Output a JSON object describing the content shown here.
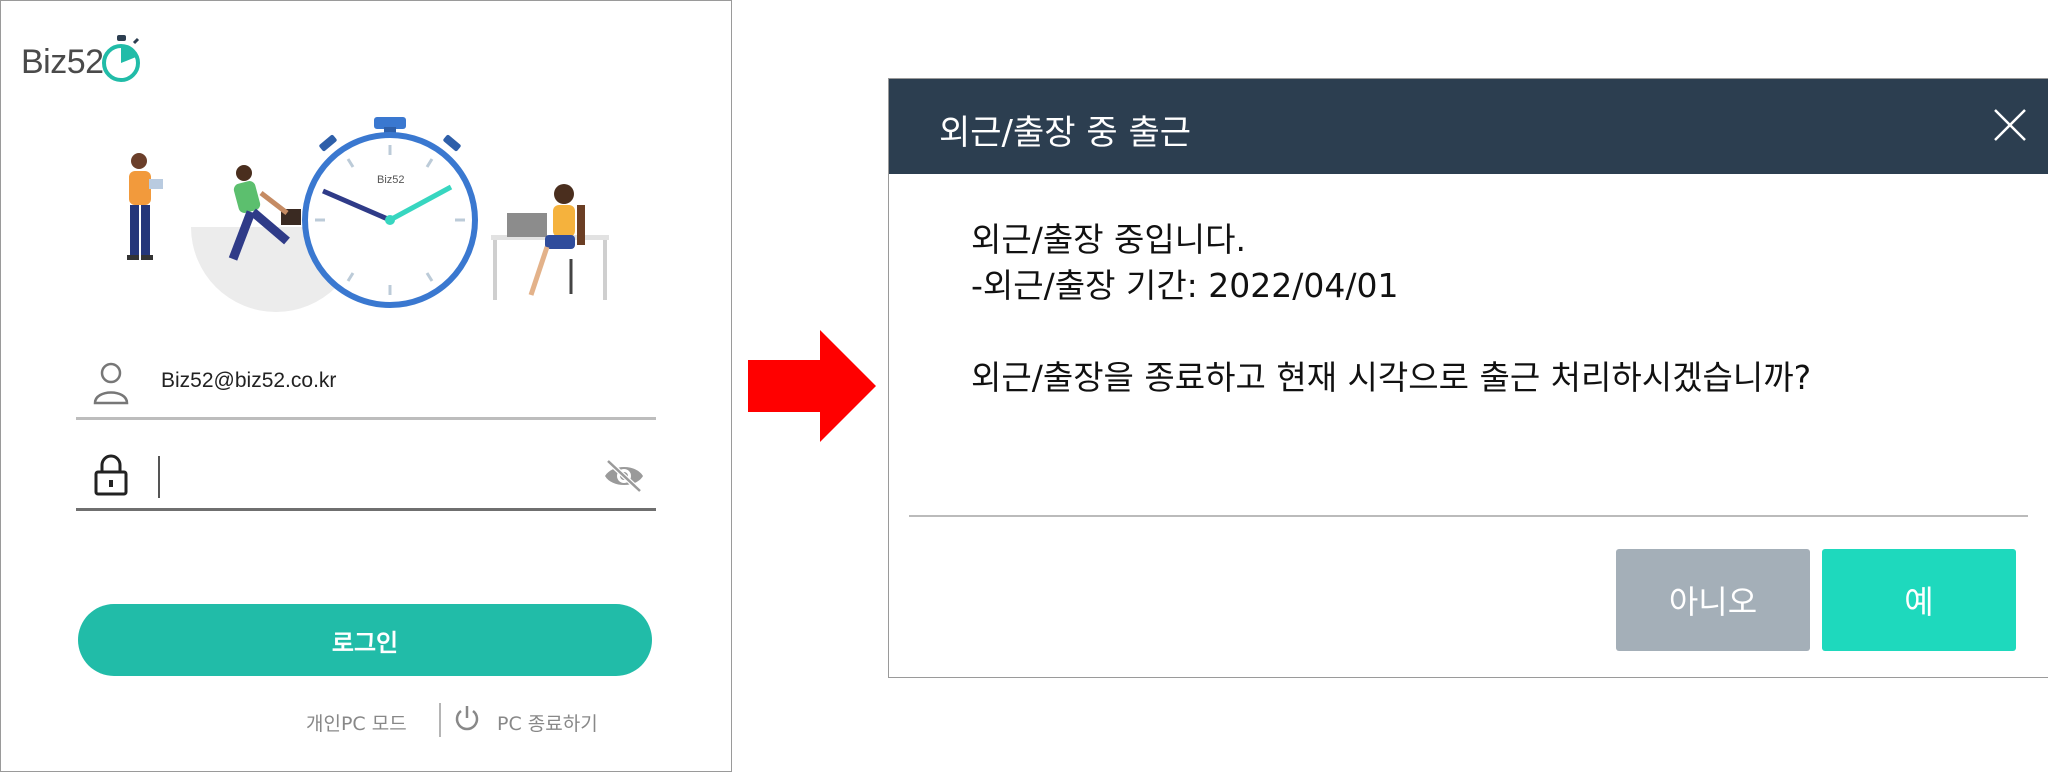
{
  "login": {
    "logo_text": "Biz52",
    "email_value": "Biz52@biz52.co.kr",
    "password_value": "",
    "login_button": "로그인",
    "pc_mode_link": "개인PC 모드",
    "pc_shutdown_link": "PC 종료하기",
    "illustration_clock_label": "Biz52"
  },
  "dialog": {
    "title": "외근/출장 중 출근",
    "lines": [
      "외근/출장 중입니다.",
      "-외근/출장 기간: 2022/04/01",
      "외근/출장을 종료하고 현재 시각으로 출근 처리하시겠습니까?"
    ],
    "no_button": "아니오",
    "yes_button": "예"
  },
  "colors": {
    "accent": "#21bca8",
    "dialog_header": "#2c3e50",
    "yes_button": "#1ed9bd",
    "no_button": "#a4afb8",
    "arrow": "#ff0000"
  },
  "icons": [
    "stopwatch-logo-icon",
    "user-icon",
    "lock-icon",
    "eye-off-icon",
    "power-icon",
    "close-icon",
    "right-arrow-icon"
  ]
}
